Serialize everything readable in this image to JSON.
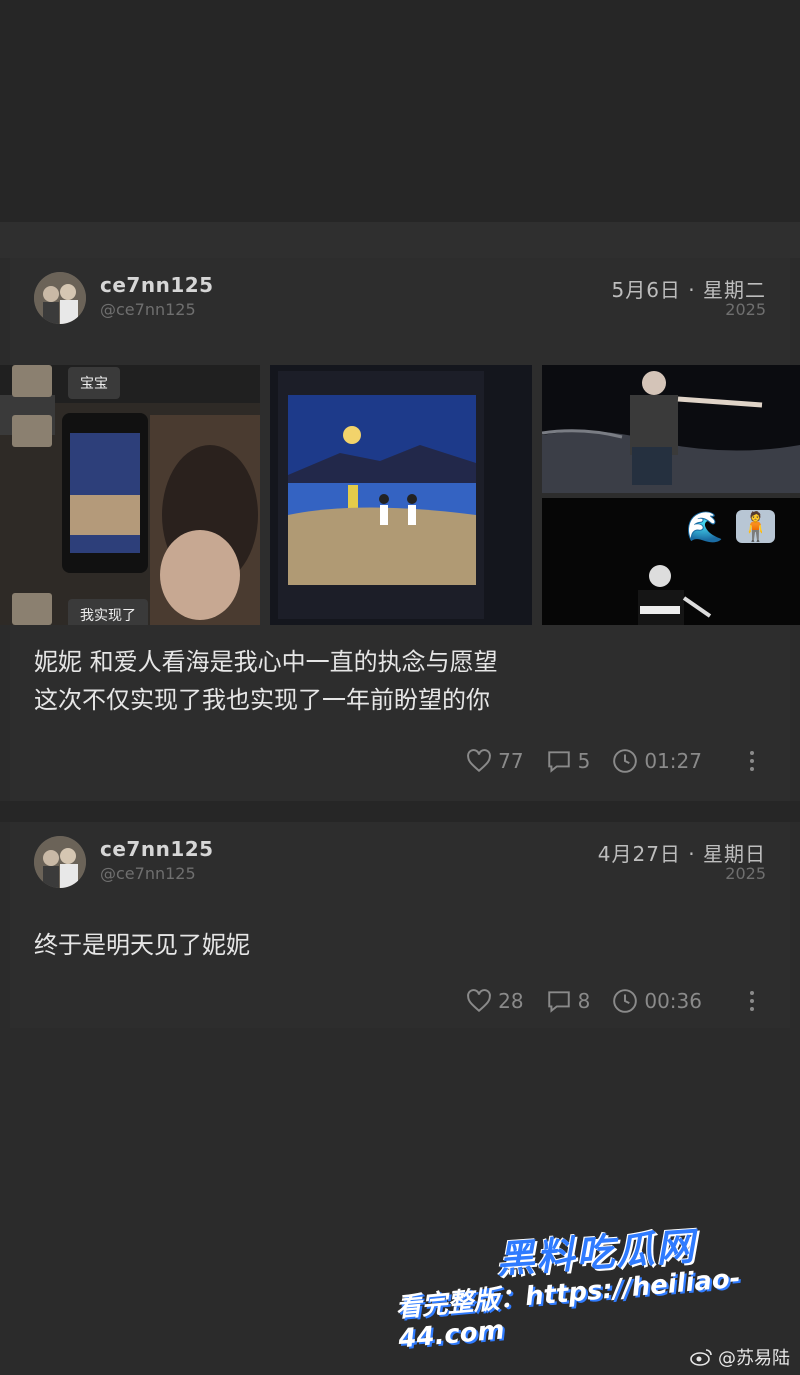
{
  "posts": [
    {
      "username": "ce7nn125",
      "handle": "@ce7nn125",
      "date": "5月6日 · 星期二",
      "year": "2025",
      "media": {
        "chat_top": "宝宝",
        "chat_bottom": "我实现了",
        "emoji_wave": "🌊",
        "emoji_person": "🧍"
      },
      "caption_lines": [
        "妮妮 和爱人看海是我心中一直的执念与愿望",
        "这次不仅实现了我也实现了一年前盼望的你"
      ],
      "likes": "77",
      "comments": "5",
      "duration": "01:27"
    },
    {
      "username": "ce7nn125",
      "handle": "@ce7nn125",
      "date": "4月27日 · 星期日",
      "year": "2025",
      "caption_lines": [
        "终于是明天见了妮妮"
      ],
      "likes": "28",
      "comments": "8",
      "duration": "00:36"
    }
  ],
  "watermark": {
    "brand": "黑料吃瓜网",
    "url_text": "看完整版：https://heiliao-44.com",
    "weibo_handle": "@苏易陆"
  }
}
